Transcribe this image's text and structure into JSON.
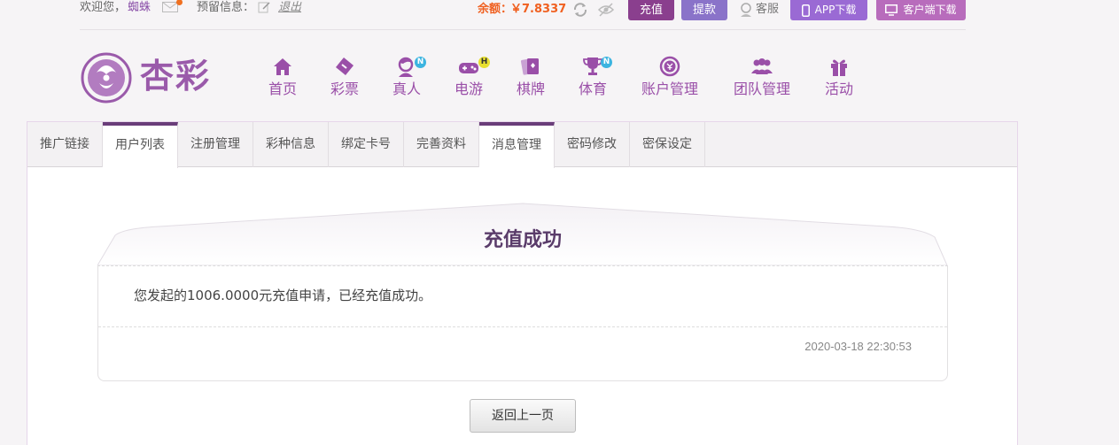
{
  "topbar": {
    "welcome": "欢迎您，",
    "username": "蜘蛛",
    "reserve_label": "预留信息：",
    "logout": "退出",
    "balance_label": "余额：",
    "balance_value": "￥7.8337",
    "recharge": "充值",
    "withdraw": "提款",
    "service": "客服",
    "app_download": "APP下载",
    "client_download": "客户端下载"
  },
  "logo": {
    "text": "杏彩"
  },
  "nav": [
    {
      "label": "首页",
      "icon": "home-icon"
    },
    {
      "label": "彩票",
      "icon": "lottery-ticket-icon"
    },
    {
      "label": "真人",
      "icon": "live-dealer-icon",
      "badge": "N"
    },
    {
      "label": "电游",
      "icon": "gamepad-icon",
      "badge": "H"
    },
    {
      "label": "棋牌",
      "icon": "cards-icon"
    },
    {
      "label": "体育",
      "icon": "trophy-icon",
      "badge": "N"
    },
    {
      "label": "账户管理",
      "icon": "account-icon"
    },
    {
      "label": "团队管理",
      "icon": "team-icon"
    },
    {
      "label": "活动",
      "icon": "gift-icon"
    }
  ],
  "tabs": [
    {
      "label": "推广链接"
    },
    {
      "label": "用户列表"
    },
    {
      "label": "注册管理"
    },
    {
      "label": "彩种信息"
    },
    {
      "label": "绑定卡号"
    },
    {
      "label": "完善资料"
    },
    {
      "label": "消息管理"
    },
    {
      "label": "密码修改"
    },
    {
      "label": "密保设定"
    }
  ],
  "active_tabs": [
    "用户列表",
    "消息管理"
  ],
  "message": {
    "title": "充值成功",
    "body": "您发起的1006.0000元充值申请，已经充值成功。",
    "time": "2020-03-18 22:30:53"
  },
  "back_button": "返回上一页",
  "colors": {
    "accent": "#9a4fa8",
    "balance": "#f06020",
    "recharge_bg": "#8a3f8e",
    "withdraw_bg": "#8a73c9"
  }
}
